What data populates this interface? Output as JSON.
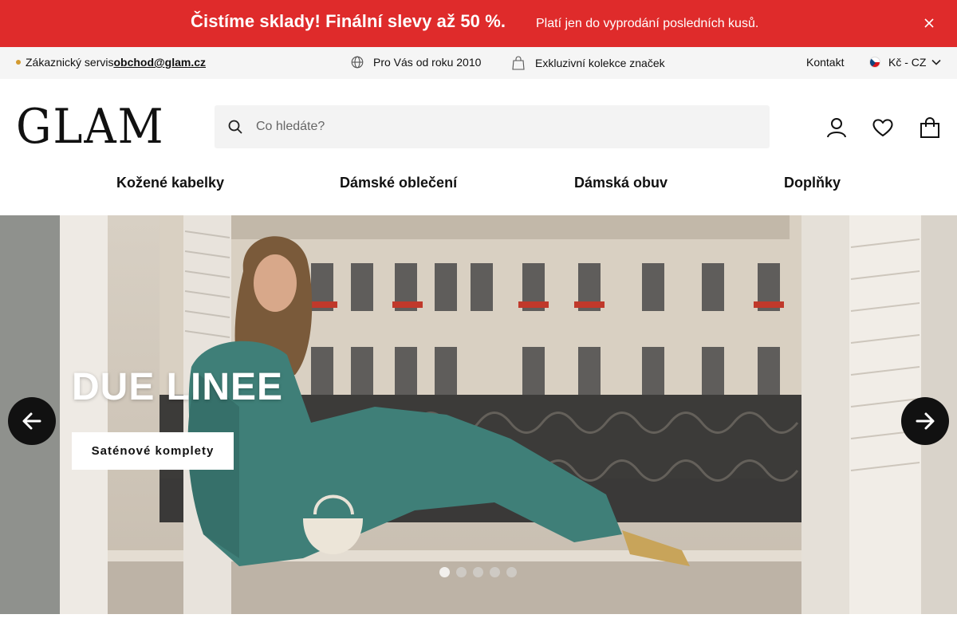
{
  "promo": {
    "headline": "Čistíme sklady! Finální slevy až 50 %.",
    "subtext": "Platí jen do vyprodání posledních kusů.",
    "close_icon": "close-icon",
    "background": "#df2b2b"
  },
  "infobar": {
    "service_label": "Zákaznický servis ",
    "service_email": "obchod@glam.cz",
    "since": "Pro Vás od roku 2010",
    "exclusive": "Exkluzivní kolekce značek",
    "contact": "Kontakt",
    "currency": "Kč - CZ"
  },
  "header": {
    "logo": "GLAM",
    "search_placeholder": "Co hledáte?",
    "icons": [
      "user-icon",
      "heart-icon",
      "cart-icon"
    ]
  },
  "nav": {
    "items": [
      "Kožené kabelky",
      "Dámské oblečení",
      "Dámská obuv",
      "Doplňky"
    ]
  },
  "hero": {
    "title": "DUE LINEE",
    "button": "Saténové komplety",
    "slides": 5,
    "active_slide": 1
  }
}
